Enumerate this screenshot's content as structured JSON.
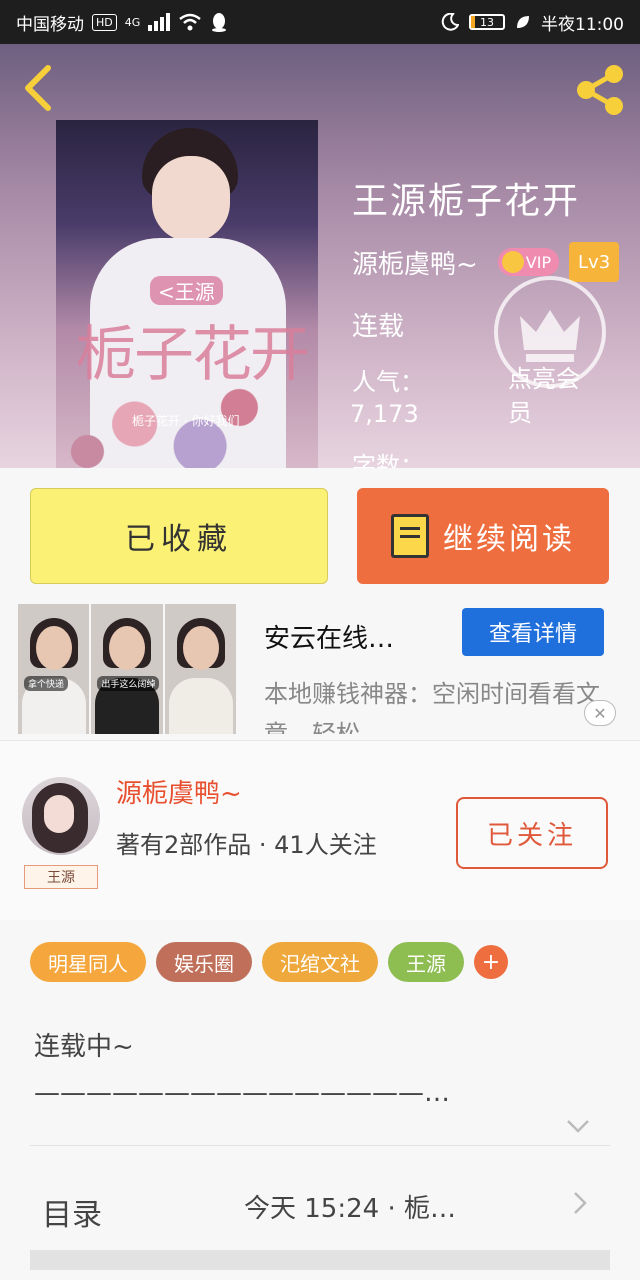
{
  "status_bar": {
    "carrier": "中国移动",
    "hd": "HD",
    "network": "4G",
    "battery": "13",
    "battery_level": 0.13,
    "time": "半夜11:00"
  },
  "book": {
    "cover_title": "栀子花开",
    "cover_tag": "<王源",
    "cover_caption": "栀子花开 · 你好我们",
    "title": "王源栀子花开",
    "author": "源栀虞鸭~",
    "vip_label": "VIP",
    "level": "Lv3",
    "status": "连载",
    "popularity_label": "人气：",
    "popularity_value": "7,173",
    "light_up": "点亮会员",
    "wordcount_label": "字数："
  },
  "actions": {
    "collected_label": "已收藏",
    "read_label": "继续阅读"
  },
  "ad": {
    "title": "安云在线…",
    "detail_label": "查看详情",
    "description": "本地赚钱神器：空闲时间看看文章，轻松…",
    "close_label": "✕",
    "image_captions": [
      "拿个快递",
      "出手这么阔绰",
      ""
    ]
  },
  "author_card": {
    "name": "源栀虞鸭~",
    "stats": "著有2部作品 · 41人关注",
    "avatar_tag": "王源",
    "follow_label": "已关注"
  },
  "tags": [
    {
      "label": "明星同人",
      "color": "#f5a63c"
    },
    {
      "label": "娱乐圈",
      "color": "#c0705a"
    },
    {
      "label": "汜绾文社",
      "color": "#efa83c"
    },
    {
      "label": "王源",
      "color": "#8ebd52"
    }
  ],
  "add_tag_label": "+",
  "synopsis": {
    "line1": "连载中~",
    "line2": "———————————————…"
  },
  "catalog": {
    "label": "目录",
    "update": "今天 15:24 · 栀…"
  }
}
